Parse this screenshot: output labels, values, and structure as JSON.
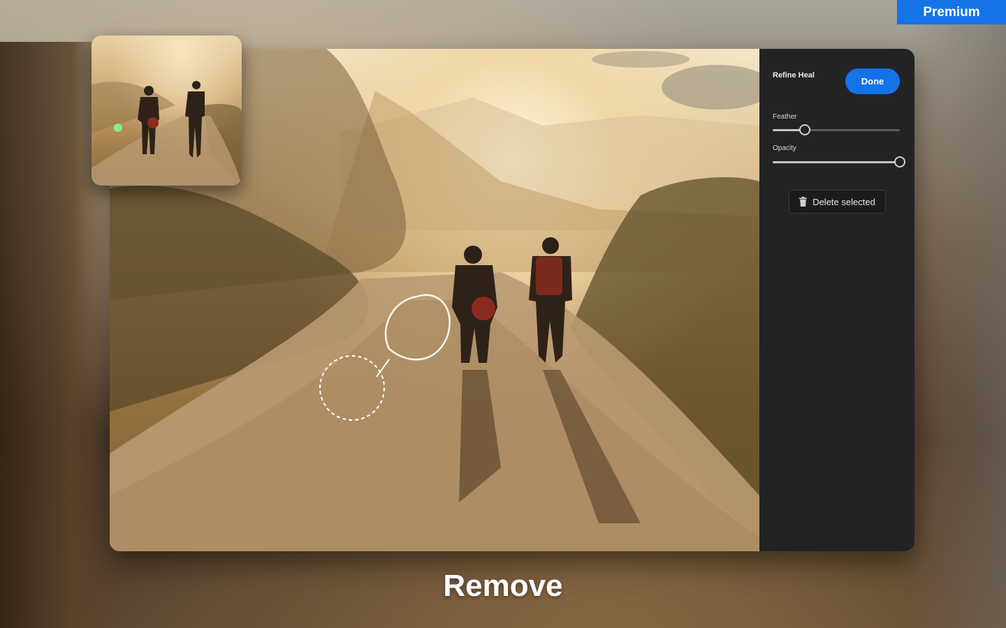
{
  "header": {
    "premium_label": "Premium"
  },
  "refine_panel": {
    "title": "Refine Heal",
    "done_label": "Done",
    "feather": {
      "label": "Feather",
      "value": 0.25
    },
    "opacity": {
      "label": "Opacity",
      "value": 1.0
    },
    "delete_label": "Delete selected"
  },
  "caption": "Remove",
  "colors": {
    "accent": "#1473e6",
    "panel_bg": "#222325"
  }
}
